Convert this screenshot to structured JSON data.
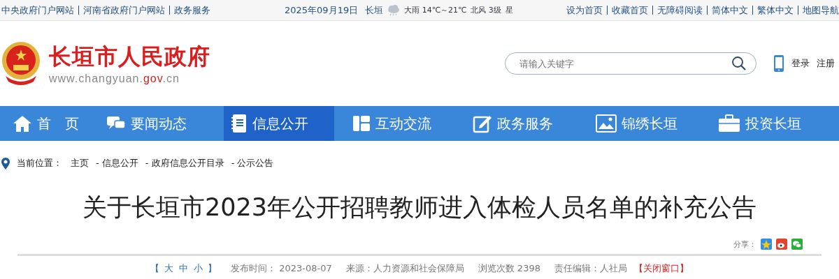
{
  "top_bar": {
    "left_links": [
      "中央政府门户网站",
      "河南省政府门户网站",
      "政务服务"
    ],
    "date": "2025年09月19日",
    "city": "长垣",
    "weather": "大雨 14℃～21℃",
    "wind": "北风 3级",
    "extra": "星",
    "right_links": [
      "设为首页",
      "收藏首页",
      "无障碍阅读",
      "简体中文",
      "繁体中文",
      "地图导航"
    ]
  },
  "header": {
    "site_name": "长垣市人民政府",
    "domain": [
      {
        "text": "www.changyuan.",
        "highlight": false
      },
      {
        "text": "gov",
        "highlight": true
      },
      {
        "text": ".cn",
        "highlight": false
      }
    ],
    "search": {
      "placeholder": "请输入关键字"
    },
    "account_links": [
      "登录",
      "注册"
    ]
  },
  "nav": [
    {
      "label": "首　页",
      "selected": false
    },
    {
      "label": "要闻动态",
      "selected": false
    },
    {
      "label": "信息公开",
      "selected": true
    },
    {
      "label": "互动交流",
      "selected": false
    },
    {
      "label": "政务服务",
      "selected": false
    },
    {
      "label": "锦绣长垣",
      "selected": false
    },
    {
      "label": "投资长垣",
      "selected": false
    }
  ],
  "breadcrumb": {
    "label": "当前位置：",
    "items": [
      "主页",
      "- 信息公开",
      "- 政府信息公开目录",
      "- 公示公告"
    ]
  },
  "article": {
    "title": "关于长垣市2023年公开招聘教师进入体检人员名单的补充公告",
    "share_label": "分享：",
    "meta": {
      "size_open": "【",
      "sizes": [
        "大",
        "中",
        "小"
      ],
      "size_close": "】",
      "publish_time": "发布时间：  2023-08-07",
      "source": "来源：人力资源和社会保障局",
      "views": "浏览次数 2398",
      "editor": "责任编辑：人社局",
      "close": "【关闭窗口】"
    }
  }
}
